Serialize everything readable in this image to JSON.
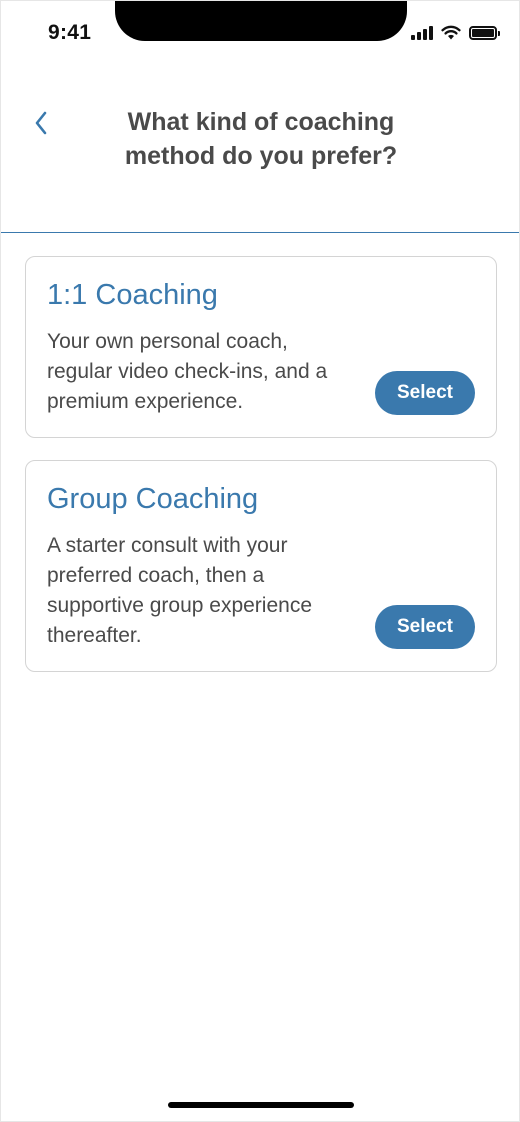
{
  "status_bar": {
    "time": "9:41",
    "icons": [
      "cellular-signal-icon",
      "wifi-icon",
      "battery-icon"
    ]
  },
  "header": {
    "title": "What kind of coaching method do you prefer?",
    "back_icon": "chevron-left-icon"
  },
  "options": [
    {
      "title": "1:1 Coaching",
      "description": "Your own personal coach, regular video check-ins, and a premium experience.",
      "button_label": "Select"
    },
    {
      "title": "Group Coaching",
      "description": "A starter consult with your preferred coach, then a supportive group experience thereafter.",
      "button_label": "Select"
    }
  ],
  "colors": {
    "accent": "#3a79ad",
    "title_text": "#4a4a4a",
    "body_text": "#4a4a4a",
    "card_border": "#d4d4d4"
  }
}
